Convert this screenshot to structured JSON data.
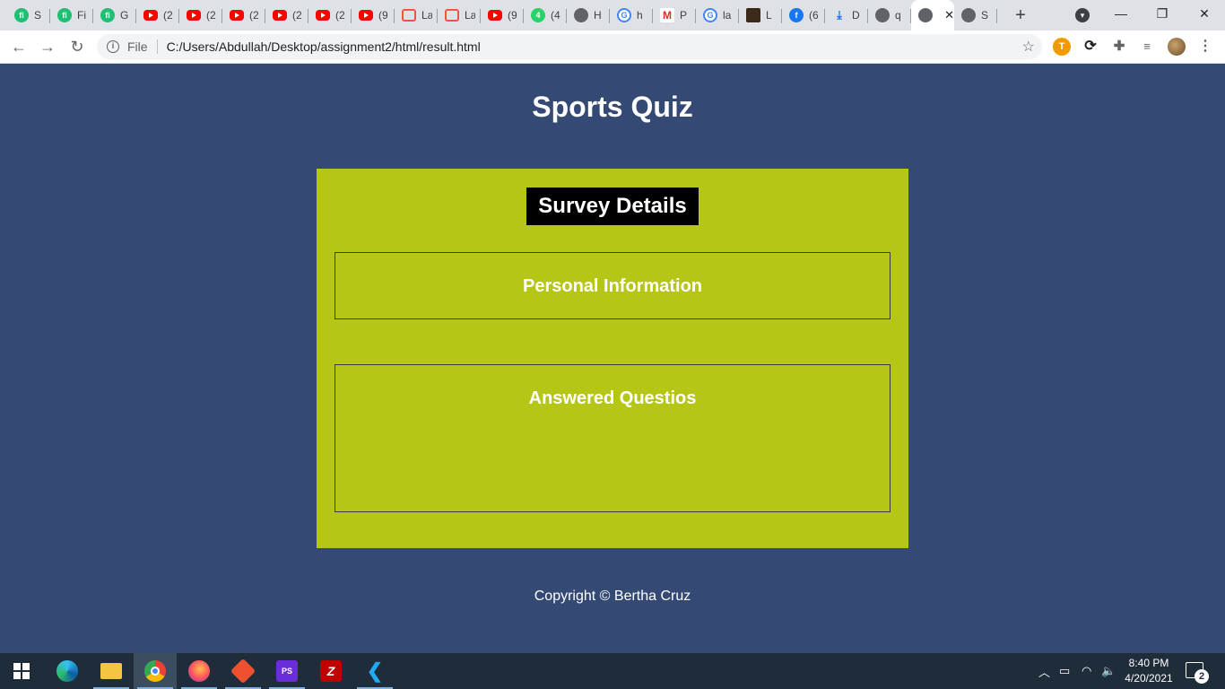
{
  "browser": {
    "tabs": [
      {
        "title": "S",
        "favicon": "fiverr-icon"
      },
      {
        "title": "Fi",
        "favicon": "fiverr-icon"
      },
      {
        "title": "G",
        "favicon": "fiverr-icon"
      },
      {
        "title": "(2",
        "favicon": "youtube-icon"
      },
      {
        "title": "(2",
        "favicon": "youtube-icon"
      },
      {
        "title": "(2",
        "favicon": "youtube-icon"
      },
      {
        "title": "(2",
        "favicon": "youtube-icon"
      },
      {
        "title": "(2",
        "favicon": "youtube-icon"
      },
      {
        "title": "(9",
        "favicon": "youtube-icon"
      },
      {
        "title": "La",
        "favicon": "laravel-icon"
      },
      {
        "title": "La",
        "favicon": "laravel-icon"
      },
      {
        "title": "(9",
        "favicon": "youtube-icon"
      },
      {
        "title": "(4",
        "favicon": "whatsapp-icon"
      },
      {
        "title": "H",
        "favicon": "globe-icon"
      },
      {
        "title": "h",
        "favicon": "google-icon"
      },
      {
        "title": "P",
        "favicon": "gmail-icon"
      },
      {
        "title": "la",
        "favicon": "google-icon"
      },
      {
        "title": "L",
        "favicon": "book-icon"
      },
      {
        "title": "(6",
        "favicon": "facebook-icon"
      },
      {
        "title": "D",
        "favicon": "download-icon"
      },
      {
        "title": "q",
        "favicon": "globe-icon"
      },
      {
        "title": "",
        "favicon": "globe-icon",
        "active": true
      },
      {
        "title": "S",
        "favicon": "globe-icon"
      }
    ],
    "address": {
      "scheme_label": "File",
      "url": "C:/Users/Abdullah/Desktop/assignment2/html/result.html"
    }
  },
  "page": {
    "title": "Sports Quiz",
    "card_title": "Survey Details",
    "personal_heading": "Personal Information",
    "answers_heading": "Answered Questios",
    "footer": "Copyright © Bertha Cruz"
  },
  "colors": {
    "page_bg": "#344a74",
    "card_bg": "#b6c617",
    "title_bg": "#000000"
  },
  "taskbar": {
    "apps": [
      "windows-start-icon",
      "edge-icon",
      "file-explorer-icon",
      "chrome-icon",
      "firefox-icon",
      "git-icon",
      "phpstorm-icon",
      "filezilla-icon",
      "vscode-icon"
    ],
    "time": "8:40 PM",
    "date": "4/20/2021",
    "notifications": "2"
  }
}
